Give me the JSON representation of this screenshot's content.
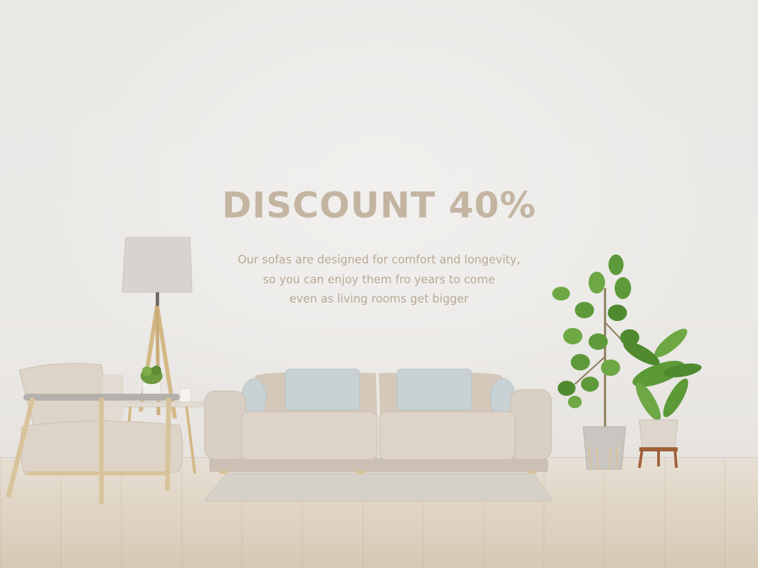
{
  "banner": {
    "headline": "DISCOUNT 40%",
    "description_lines": [
      "Our sofas are designed for comfort and longevity,",
      "so you can enjoy them fro years to come",
      "even as living rooms get bigger"
    ]
  },
  "colors": {
    "headline": "#c4b5a3",
    "body_text": "#b8a997",
    "wall": "#ebe9e6",
    "sofa": "#d9cfc4",
    "cushion": "#c8d1d3",
    "wood": "#d9c39b",
    "plant": "#5f9a3a"
  }
}
